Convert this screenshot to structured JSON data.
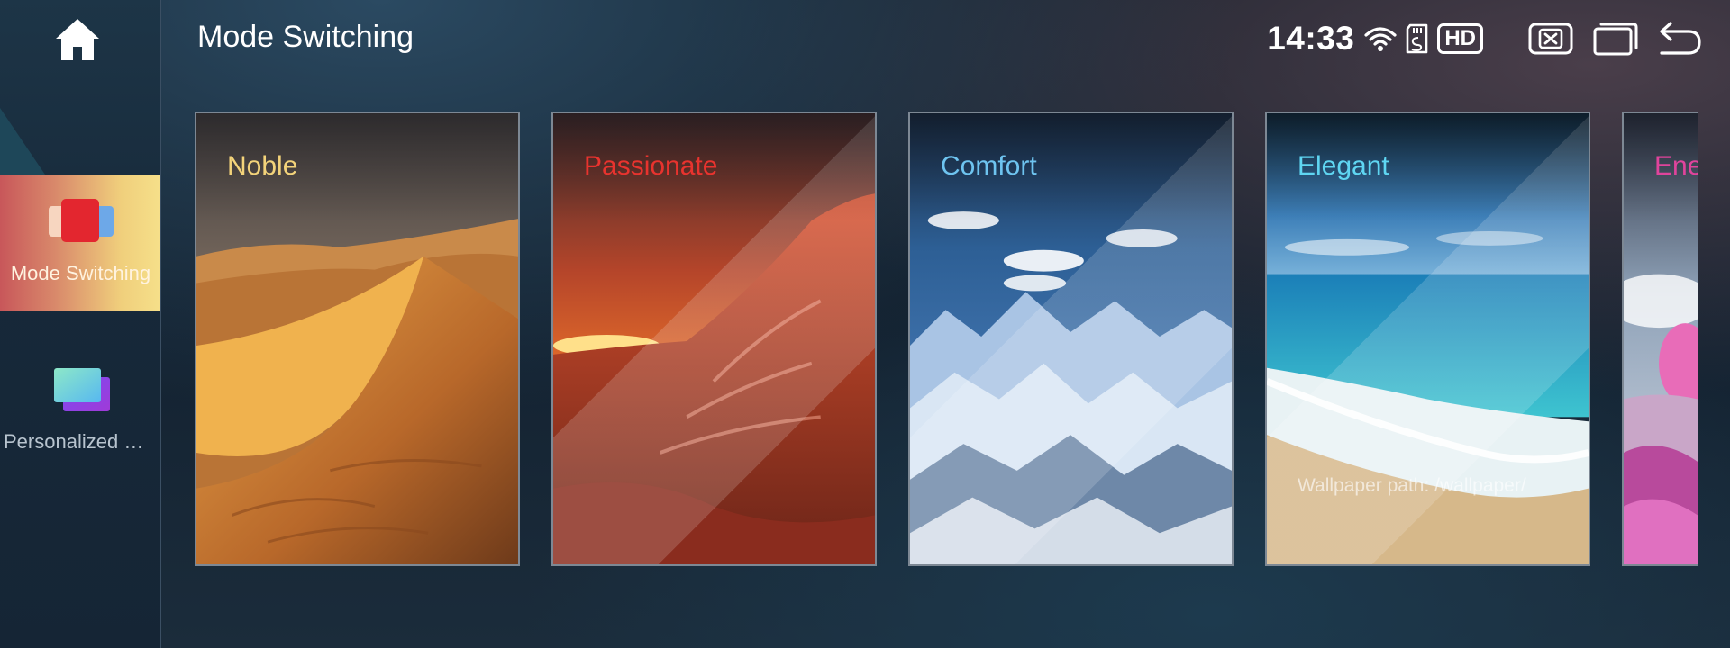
{
  "sidebar": {
    "items": [
      {
        "label": "Mode Switching",
        "active": true,
        "icon": "mode-switching-icon"
      },
      {
        "label": "Personalized wallpaper",
        "active": false,
        "icon": "wallpaper-icon"
      }
    ]
  },
  "header": {
    "title": "Mode Switching",
    "time": "14:33",
    "hd_label": "HD"
  },
  "modes": [
    {
      "label": "Noble",
      "color": "#f3d37a"
    },
    {
      "label": "Passionate",
      "color": "#e8332e"
    },
    {
      "label": "Comfort",
      "color": "#6ec4f0"
    },
    {
      "label": "Elegant",
      "color": "#5fd6f2"
    },
    {
      "label": "Energetic",
      "color": "#e0449c"
    }
  ],
  "wallpaper_path": "Wallpaper path: /wallpaper/"
}
